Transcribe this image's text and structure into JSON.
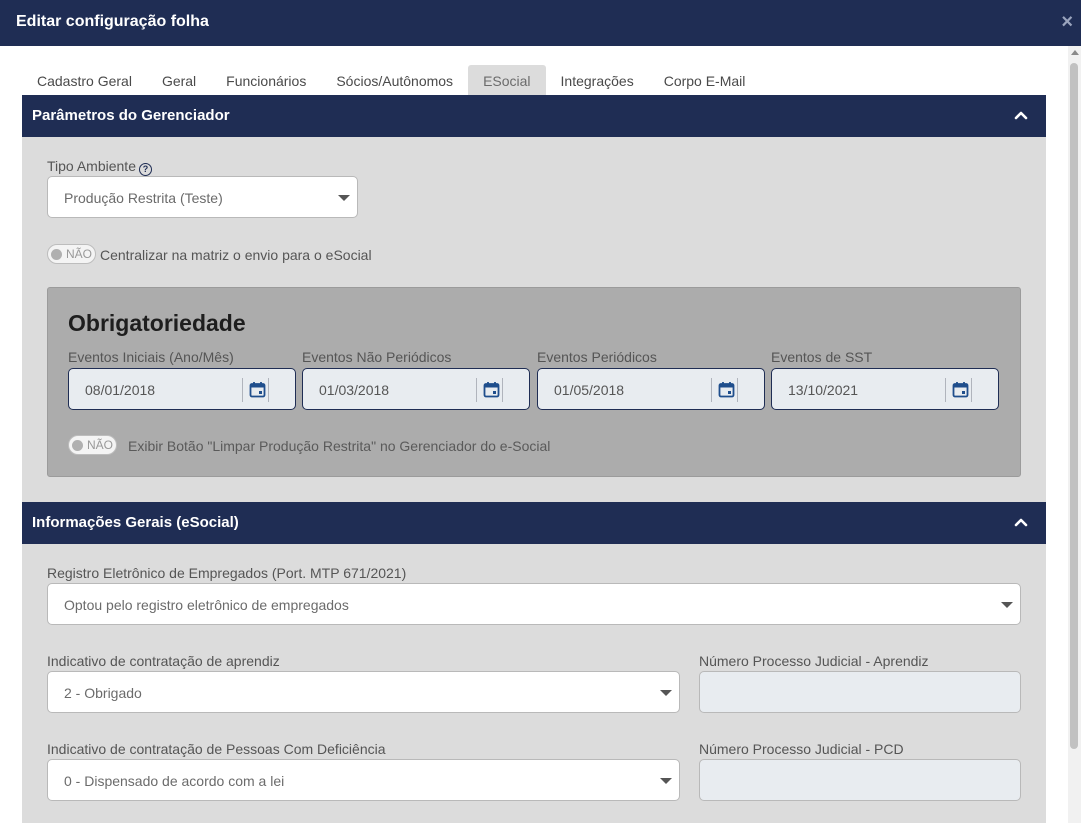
{
  "modal": {
    "title": "Editar configuração folha",
    "close_label": "×"
  },
  "tabs": [
    {
      "label": "Cadastro Geral"
    },
    {
      "label": "Geral"
    },
    {
      "label": "Funcionários"
    },
    {
      "label": "Sócios/Autônomos"
    },
    {
      "label": "ESocial",
      "active": true
    },
    {
      "label": "Integrações"
    },
    {
      "label": "Corpo E-Mail"
    }
  ],
  "section_gerenciador": {
    "title": "Parâmetros do Gerenciador",
    "tipo_ambiente_label": "Tipo Ambiente",
    "tipo_ambiente_help": "?",
    "tipo_ambiente_value": "Produção Restrita (Teste)",
    "centralizar_toggle": "NÃO",
    "centralizar_label": "Centralizar na matriz o envio para o eSocial",
    "obrigatoriedade": {
      "title": "Obrigatoriedade",
      "fields": [
        {
          "label": "Eventos Iniciais (Ano/Mês)",
          "value": "08/01/2018"
        },
        {
          "label": "Eventos Não Periódicos",
          "value": "01/03/2018"
        },
        {
          "label": "Eventos Periódicos",
          "value": "01/05/2018"
        },
        {
          "label": "Eventos de SST",
          "value": "13/10/2021"
        }
      ],
      "limpar_toggle": "NÃO",
      "limpar_label": "Exibir Botão \"Limpar Produção Restrita\" no Gerenciador do e-Social"
    }
  },
  "section_informacoes": {
    "title": "Informações Gerais (eSocial)",
    "registro_label": "Registro Eletrônico de Empregados (Port. MTP 671/2021)",
    "registro_value": "Optou pelo registro eletrônico de empregados",
    "aprendiz_label": "Indicativo de contratação de aprendiz",
    "aprendiz_value": "2 - Obrigado",
    "proc_aprendiz_label": "Número Processo Judicial - Aprendiz",
    "proc_aprendiz_value": "",
    "pcd_label": "Indicativo de contratação de Pessoas Com Deficiência",
    "pcd_value": "0 - Dispensado de acordo com a lei",
    "proc_pcd_label": "Número Processo Judicial - PCD",
    "proc_pcd_value": ""
  },
  "colors": {
    "header": "#1f2d54",
    "section_body": "#dcdcdc",
    "obrigatoriedade_box": "#acacac"
  }
}
